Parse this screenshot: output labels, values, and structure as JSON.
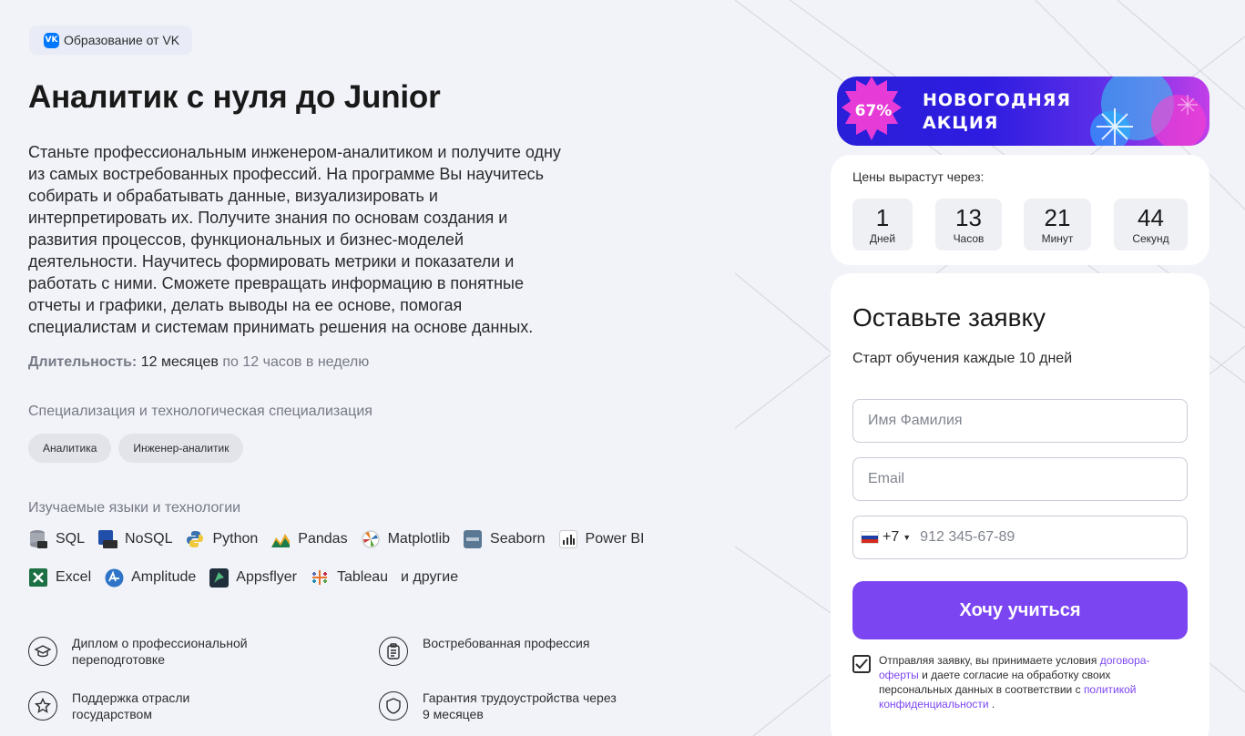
{
  "badge": {
    "logo": "VK",
    "label": "Образование от VK"
  },
  "course": {
    "title": "Аналитик с нуля до Junior",
    "description": "Станьте профессиональным инженером-аналитиком и получите одну из самых востребованных профессий. На программе Вы научитесь собирать и обрабатывать данные, визуализировать и интерпретировать их. Получите знания по основам создания и развития процессов, функциональных и бизнес-моделей деятельности. Научитесь формировать метрики и показатели и работать с ними. Сможете превращать информацию в понятные отчеты и графики, делать выводы на ее основе, помогая специалистам и системам принимать решения на основе данных.",
    "duration_label": "Длительность:",
    "duration_value": "12 месяцев",
    "duration_extra": "по 12 часов в неделю"
  },
  "specialization": {
    "title": "Специализация и технологическая специализация",
    "chips": [
      "Аналитика",
      "Инженер-аналитик"
    ]
  },
  "technologies": {
    "title": "Изучаемые языки и технологии",
    "row1": [
      {
        "name": "SQL",
        "icon": "sql-icon"
      },
      {
        "name": "NoSQL",
        "icon": "nosql-icon"
      },
      {
        "name": "Python",
        "icon": "python-icon"
      },
      {
        "name": "Pandas",
        "icon": "pandas-icon"
      },
      {
        "name": "Matplotlib",
        "icon": "matplotlib-icon"
      },
      {
        "name": "Seaborn",
        "icon": "seaborn-icon"
      },
      {
        "name": "Power BI",
        "icon": "powerbi-icon"
      }
    ],
    "row2": [
      {
        "name": "Excel",
        "icon": "excel-icon"
      },
      {
        "name": "Amplitude",
        "icon": "amplitude-icon"
      },
      {
        "name": "Appsflyer",
        "icon": "appsflyer-icon"
      },
      {
        "name": "Tableau",
        "icon": "tableau-icon"
      }
    ],
    "others": "и другие"
  },
  "features": [
    {
      "text": "Диплом о профессиональной переподготовке",
      "icon": "graduation-cap-icon"
    },
    {
      "text": "Востребованная профессия",
      "icon": "clipboard-icon"
    },
    {
      "text": "Поддержка отрасли государством",
      "icon": "star-icon"
    },
    {
      "text": "Гарантия трудоустройства через 9 месяцев",
      "icon": "shield-icon"
    }
  ],
  "promo": {
    "discount": "67%",
    "line1": "НОВОГОДНЯЯ",
    "line2": "АКЦИЯ"
  },
  "timer": {
    "label": "Цены вырастут через:",
    "days": "1",
    "days_label": "Дней",
    "hours": "13",
    "hours_label": "Часов",
    "minutes": "21",
    "minutes_label": "Минут",
    "seconds": "44",
    "seconds_label": "Секунд"
  },
  "form": {
    "title": "Оставьте заявку",
    "subtitle": "Старт обучения каждые 10 дней",
    "name_placeholder": "Имя Фамилия",
    "email_placeholder": "Email",
    "phone_code": "+7",
    "phone_placeholder": "912 345-67-89",
    "submit_label": "Хочу учиться",
    "consent_part1": "Отправляя заявку, вы принимаете условия ",
    "consent_link1": "договора-оферты",
    "consent_part2": " и даете согласие на обработку своих персональных данных в соответствии с ",
    "consent_link2": "политикой конфиденциальности",
    "consent_part3": " ."
  },
  "colors": {
    "accent": "#7b46f2",
    "vk_blue": "#0077ff",
    "background": "#f2f3f8"
  }
}
